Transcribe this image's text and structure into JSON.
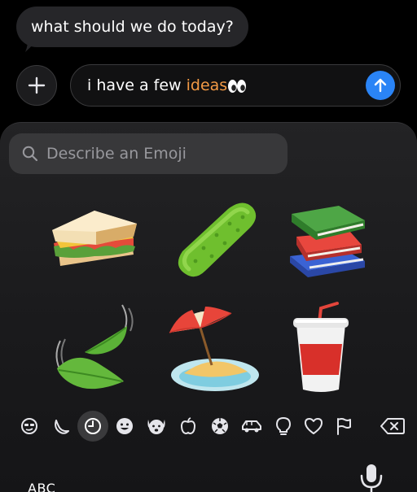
{
  "conversation": {
    "incoming_message": "what should we do today?"
  },
  "compose": {
    "text_before": "i have a few ",
    "highlighted_word": "ideas",
    "trailing_emoji": "👀"
  },
  "emoji_keyboard": {
    "search_placeholder": "Describe an Emoji",
    "emoji_results": [
      {
        "name": "sandwich",
        "char": "🥪"
      },
      {
        "name": "cucumber",
        "char": "🥒"
      },
      {
        "name": "books",
        "char": "📚"
      },
      {
        "name": "leaf fluttering in wind",
        "char": "🍃"
      },
      {
        "name": "beach with umbrella",
        "char": "🏖"
      },
      {
        "name": "cup with straw",
        "char": "🥤"
      }
    ],
    "category_icons": [
      "sticker-icon",
      "moon-icon",
      "recent-clock-icon",
      "smiley-icon",
      "animal-icon",
      "food-apple-icon",
      "soccer-ball-icon",
      "car-icon",
      "lightbulb-icon",
      "heart-icon",
      "flag-icon",
      "delete-backspace-icon"
    ],
    "active_category": "recent-clock-icon",
    "abc_label": "ABC"
  },
  "colors": {
    "accent_send": "#2a84f6",
    "highlight": "#f39a45",
    "bubble": "#262629"
  }
}
